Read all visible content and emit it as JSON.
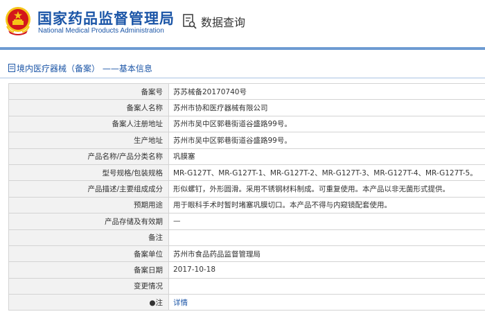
{
  "header": {
    "title_cn": "国家药品监督管理局",
    "title_en": "National Medical Products Administration",
    "data_query_label": "数据查询",
    "emblem": "national-emblem-icon",
    "query_icon": "document-search-icon"
  },
  "breadcrumb": {
    "icon": "document-icon",
    "text": "境内医疗器械（备案） ——基本信息"
  },
  "rows": [
    {
      "label": "备案号",
      "value": "苏苏械备20170740号"
    },
    {
      "label": "备案人名称",
      "value": "苏州市协和医疗器械有限公司"
    },
    {
      "label": "备案人注册地址",
      "value": "苏州市吴中区郭巷街道谷盛路99号。"
    },
    {
      "label": "生产地址",
      "value": "苏州市吴中区郭巷街道谷盛路99号。"
    },
    {
      "label": "产品名称/产品分类名称",
      "value": "巩膜塞"
    },
    {
      "label": "型号规格/包装规格",
      "value": "MR-G127T、MR-G127T-1、MR-G127T-2、MR-G127T-3、MR-G127T-4、MR-G127T-5。"
    },
    {
      "label": "产品描述/主要组成成分",
      "value": "形似螺钉，外形圆滑。采用不锈钢材料制成。可重复使用。本产品以非无菌形式提供。"
    },
    {
      "label": "预期用途",
      "value": "用于眼科手术时暂时堵塞巩膜切口。本产品不得与内窥镜配套使用。"
    },
    {
      "label": "产品存储及有效期",
      "value": "—"
    },
    {
      "label": "备注",
      "value": ""
    },
    {
      "label": "备案单位",
      "value": "苏州市食品药品监督管理局"
    },
    {
      "label": "备案日期",
      "value": "2017-10-18"
    },
    {
      "label": "变更情况",
      "value": ""
    },
    {
      "label": "●注",
      "value": "详情"
    }
  ],
  "colors": {
    "brand_blue": "#1c56a7",
    "accent_line": "#6d9bd2",
    "emblem_red": "#d3171b",
    "emblem_gold": "#f5c518"
  }
}
